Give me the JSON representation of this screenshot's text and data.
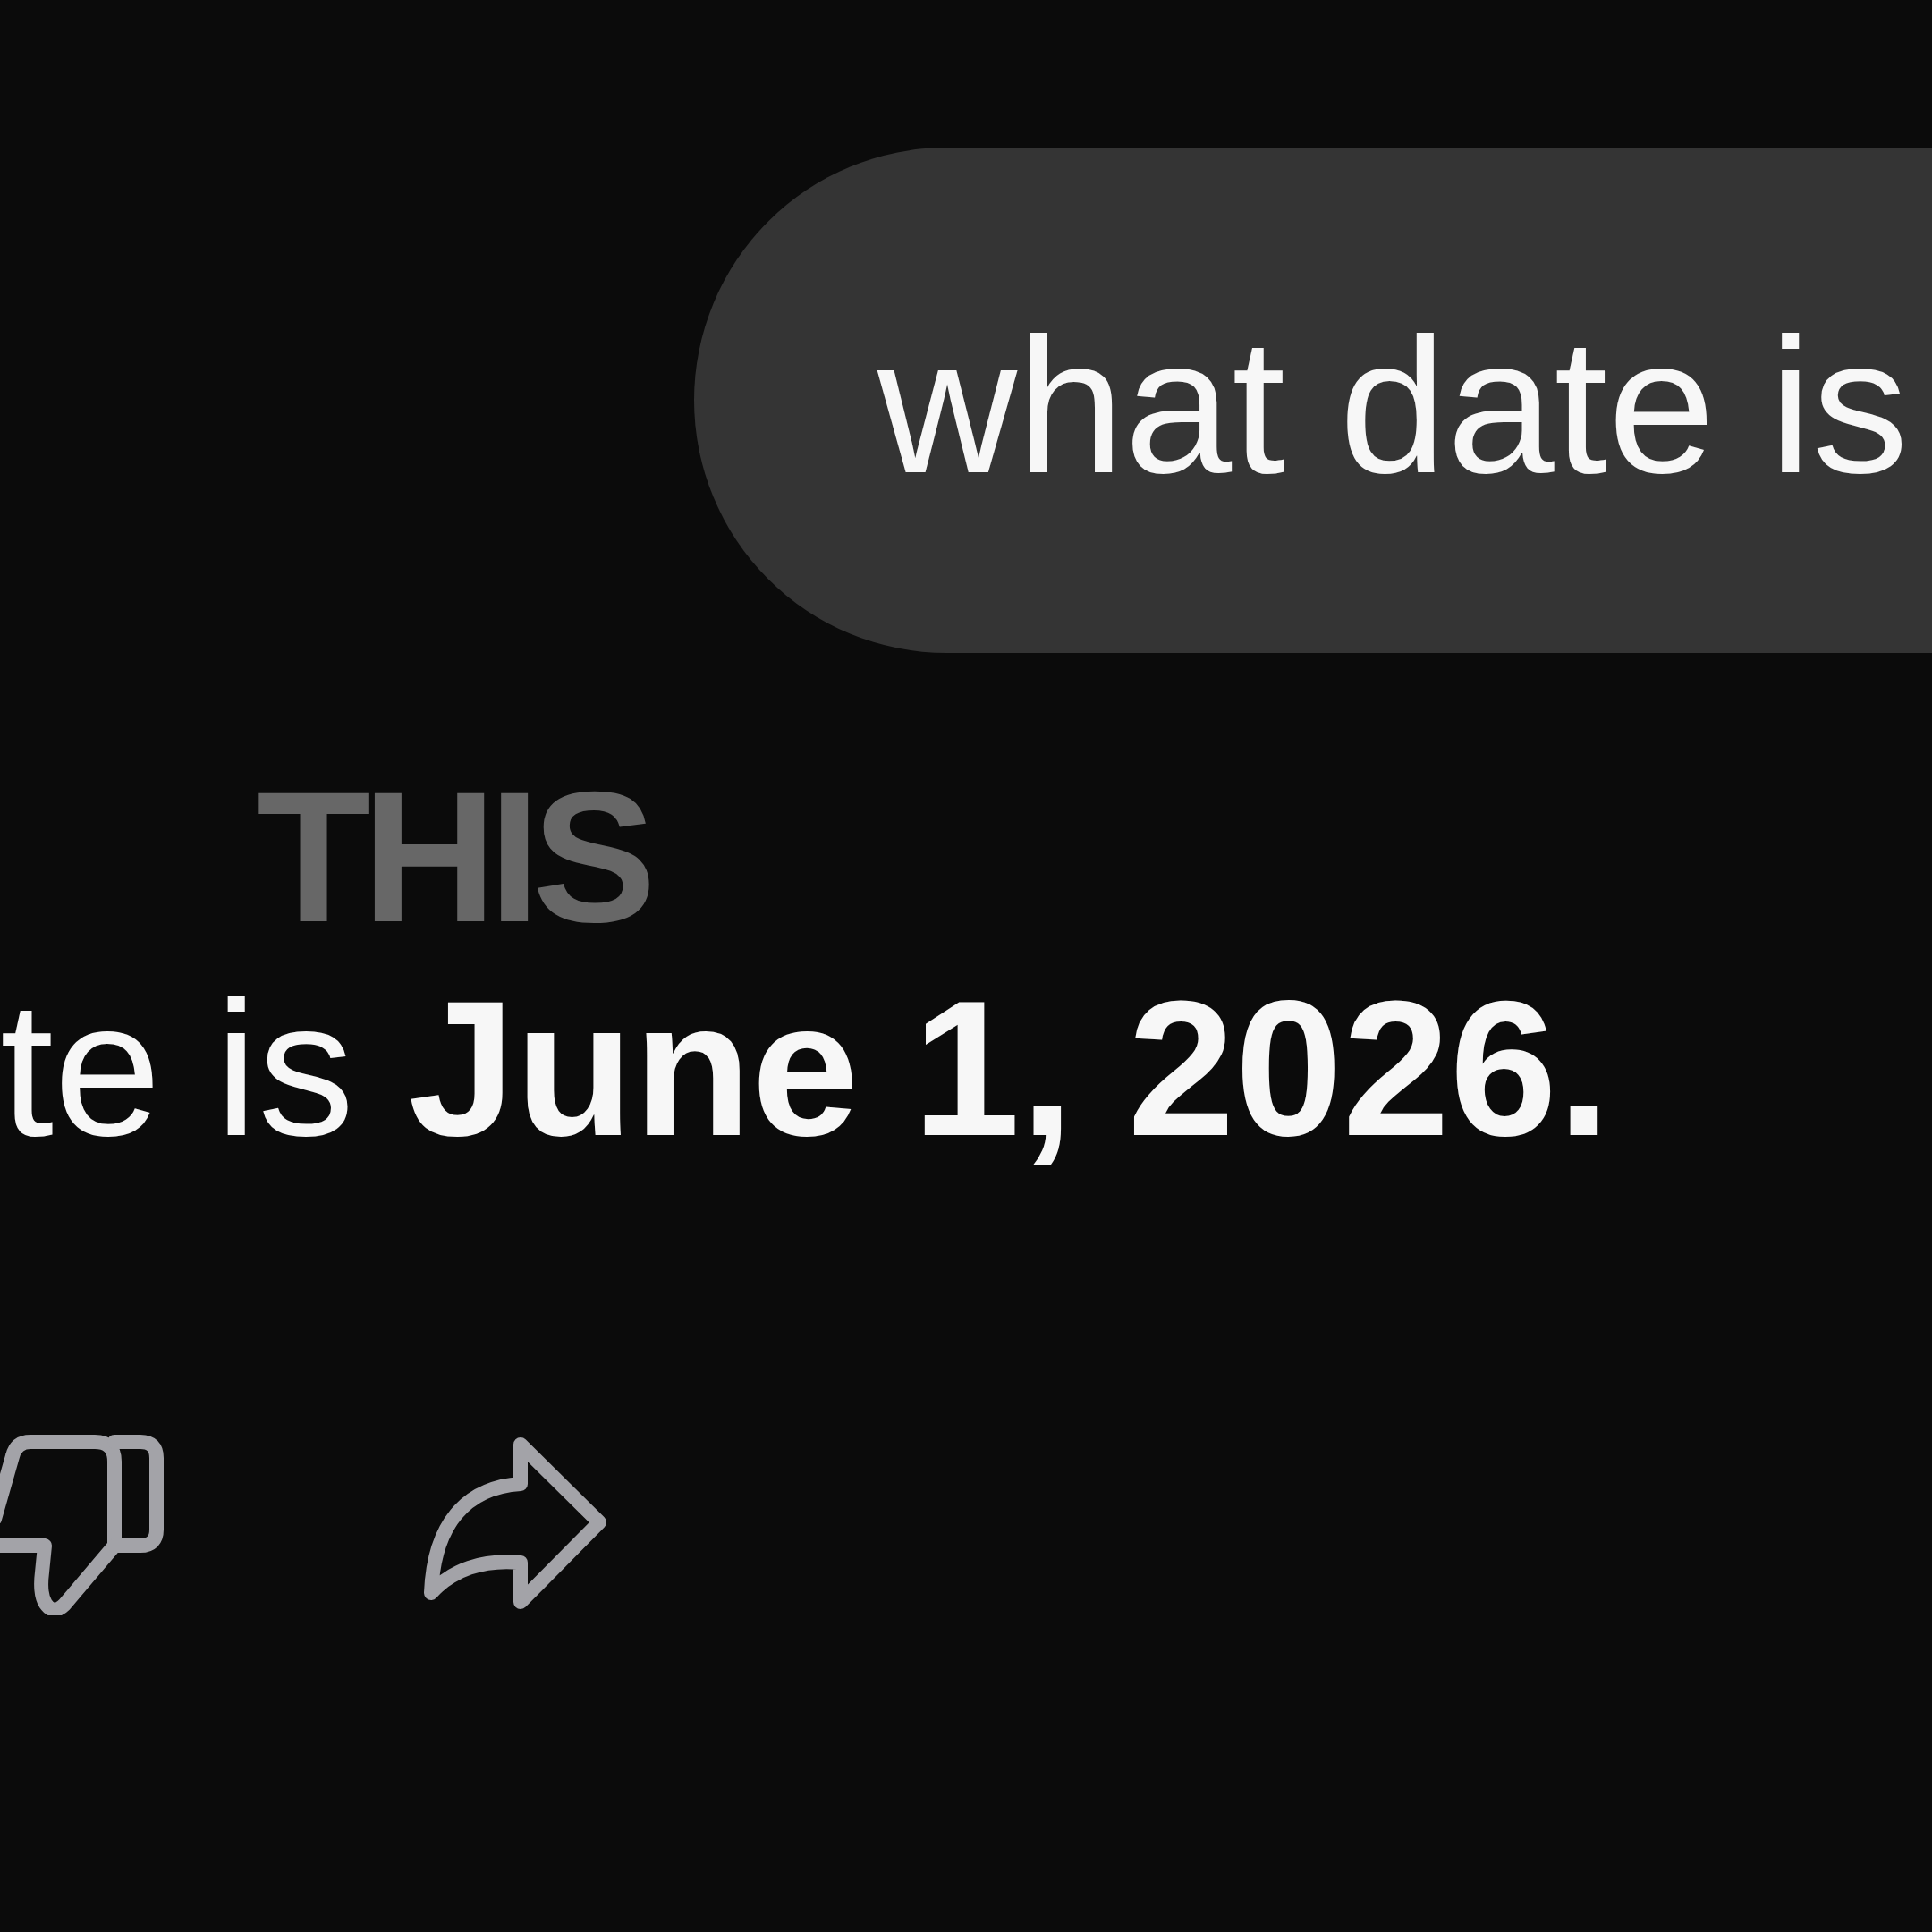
{
  "user_message": {
    "text": "what date is"
  },
  "caption": {
    "text": "THIS"
  },
  "assistant_message": {
    "text": "te is **June 1, 2026.**"
  },
  "message_actions": [
    {
      "kind": "dislike"
    },
    {
      "kind": "share"
    }
  ]
}
